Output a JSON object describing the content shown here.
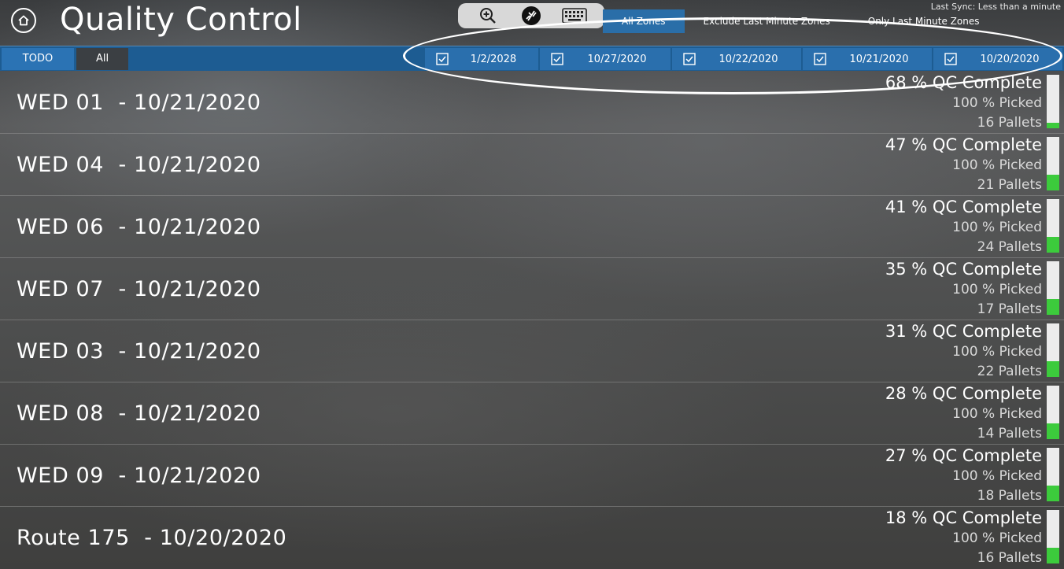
{
  "header": {
    "title": "Quality Control",
    "sync_text": "Last Sync: Less than a minute",
    "tools": [
      {
        "name": "zoom-in-icon"
      },
      {
        "name": "no-connection-icon"
      },
      {
        "name": "keyboard-icon"
      }
    ],
    "zone_tabs": [
      {
        "label": "All Zones",
        "active": true
      },
      {
        "label": "Exclude Last Minute Zones",
        "active": false
      },
      {
        "label": "Only Last Minute Zones",
        "active": false
      }
    ]
  },
  "filter": {
    "tabs": [
      {
        "label": "TODO",
        "active": true
      },
      {
        "label": "All",
        "active": false
      }
    ],
    "dates": [
      {
        "label": "1/2/2028",
        "checked": true
      },
      {
        "label": "10/27/2020",
        "checked": true
      },
      {
        "label": "10/22/2020",
        "checked": true
      },
      {
        "label": "10/21/2020",
        "checked": true
      },
      {
        "label": "10/20/2020",
        "checked": true
      }
    ]
  },
  "routes": [
    {
      "name": "WED 01  - 10/21/2020",
      "qc": "68 % QC Complete",
      "picked": "100 % Picked",
      "pallets": "16 Pallets",
      "progress": 0.1
    },
    {
      "name": "WED 04  - 10/21/2020",
      "qc": "47 % QC Complete",
      "picked": "100 % Picked",
      "pallets": "21 Pallets",
      "progress": 0.3
    },
    {
      "name": "WED 06  - 10/21/2020",
      "qc": "41 % QC Complete",
      "picked": "100 % Picked",
      "pallets": "24 Pallets",
      "progress": 0.3
    },
    {
      "name": "WED 07  - 10/21/2020",
      "qc": "35 % QC Complete",
      "picked": "100 % Picked",
      "pallets": "17 Pallets",
      "progress": 0.3
    },
    {
      "name": "WED 03  - 10/21/2020",
      "qc": "31 % QC Complete",
      "picked": "100 % Picked",
      "pallets": "22 Pallets",
      "progress": 0.3
    },
    {
      "name": "WED 08  - 10/21/2020",
      "qc": "28 % QC Complete",
      "picked": "100 % Picked",
      "pallets": "14 Pallets",
      "progress": 0.3
    },
    {
      "name": "WED 09  - 10/21/2020",
      "qc": "27 % QC Complete",
      "picked": "100 % Picked",
      "pallets": "18 Pallets",
      "progress": 0.3
    },
    {
      "name": "Route 175  - 10/20/2020",
      "qc": "18 % QC Complete",
      "picked": "100 % Picked",
      "pallets": "16 Pallets",
      "progress": 0.3
    }
  ],
  "colors": {
    "accent": "#2a6fad",
    "filter_bar": "#1d5c92",
    "progress_fill": "#3ccb3c",
    "progress_track": "#ececec",
    "highlight": "#ffffff"
  }
}
